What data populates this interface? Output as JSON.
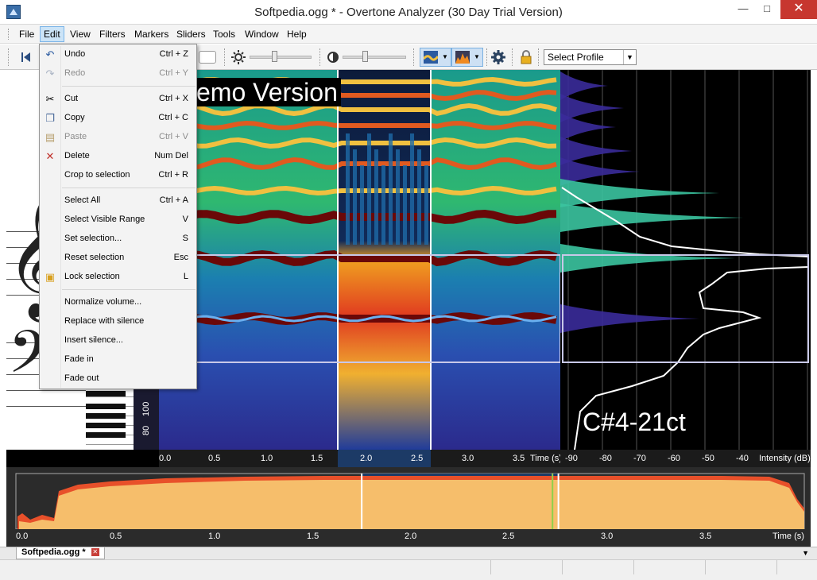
{
  "window": {
    "title": "Softpedia.ogg * - Overtone Analyzer (30 Day Trial Version)",
    "min": "—",
    "max": "□",
    "close": "✕"
  },
  "menubar": [
    "File",
    "Edit",
    "View",
    "Filters",
    "Markers",
    "Sliders",
    "Tools",
    "Window",
    "Help"
  ],
  "toolbar": {
    "profile": "Select Profile"
  },
  "edit_menu": [
    {
      "label": "Undo",
      "shortcut": "Ctrl + Z",
      "icon": "undo-icon",
      "disabled": false
    },
    {
      "label": "Redo",
      "shortcut": "Ctrl + Y",
      "icon": "redo-icon",
      "disabled": true
    },
    {
      "label": "Cut",
      "shortcut": "Ctrl + X",
      "icon": "scissors-icon",
      "disabled": false
    },
    {
      "label": "Copy",
      "shortcut": "Ctrl + C",
      "icon": "copy-icon",
      "disabled": false
    },
    {
      "label": "Paste",
      "shortcut": "Ctrl + V",
      "icon": "paste-icon",
      "disabled": true
    },
    {
      "label": "Delete",
      "shortcut": "Num Del",
      "icon": "delete-icon",
      "disabled": false
    },
    {
      "label": "Crop to selection",
      "shortcut": "Ctrl + R",
      "icon": "",
      "disabled": false
    },
    {
      "label": "Select All",
      "shortcut": "Ctrl + A",
      "icon": "",
      "disabled": false
    },
    {
      "label": "Select Visible Range",
      "shortcut": "V",
      "icon": "",
      "disabled": false
    },
    {
      "label": "Set selection...",
      "shortcut": "S",
      "icon": "",
      "disabled": false
    },
    {
      "label": "Reset selection",
      "shortcut": "Esc",
      "icon": "",
      "disabled": false
    },
    {
      "label": "Lock selection",
      "shortcut": "L",
      "icon": "lock-icon",
      "disabled": false
    },
    {
      "label": "Normalize volume...",
      "shortcut": "",
      "icon": "",
      "disabled": false
    },
    {
      "label": "Replace with silence",
      "shortcut": "",
      "icon": "",
      "disabled": false
    },
    {
      "label": "Insert silence...",
      "shortcut": "",
      "icon": "",
      "disabled": false
    },
    {
      "label": "Fade in",
      "shortcut": "",
      "icon": "",
      "disabled": false
    },
    {
      "label": "Fade out",
      "shortcut": "",
      "icon": "",
      "disabled": false
    }
  ],
  "spectrogram": {
    "demo_banner": "emo Version",
    "note": "C#4-21ct",
    "freq_labels": [
      "100",
      "80"
    ],
    "time_ticks": [
      "0.0",
      "0.5",
      "1.0",
      "1.5",
      "2.0",
      "2.5",
      "3.0",
      "3.5"
    ],
    "time_unit": "Time (s)",
    "intensity_ticks": [
      "-90",
      "-80",
      "-70",
      "-60",
      "-50",
      "-40"
    ],
    "intensity_unit": "Intensity (dB)"
  },
  "waveform": {
    "time_ticks": [
      "0.0",
      "0.5",
      "1.0",
      "1.5",
      "2.0",
      "2.5",
      "3.0",
      "3.5"
    ],
    "time_unit": "Time (s)",
    "selection_start_s": 1.75,
    "selection_end_s": 2.75,
    "playhead_s": 2.72
  },
  "tabs": {
    "file": "Softpedia.ogg *"
  },
  "colors": {
    "selection": "#1c3a66",
    "wave_fill": "#f6be6b",
    "wave_edge": "#e8502a",
    "menu_highlight": "#cce4f7"
  }
}
